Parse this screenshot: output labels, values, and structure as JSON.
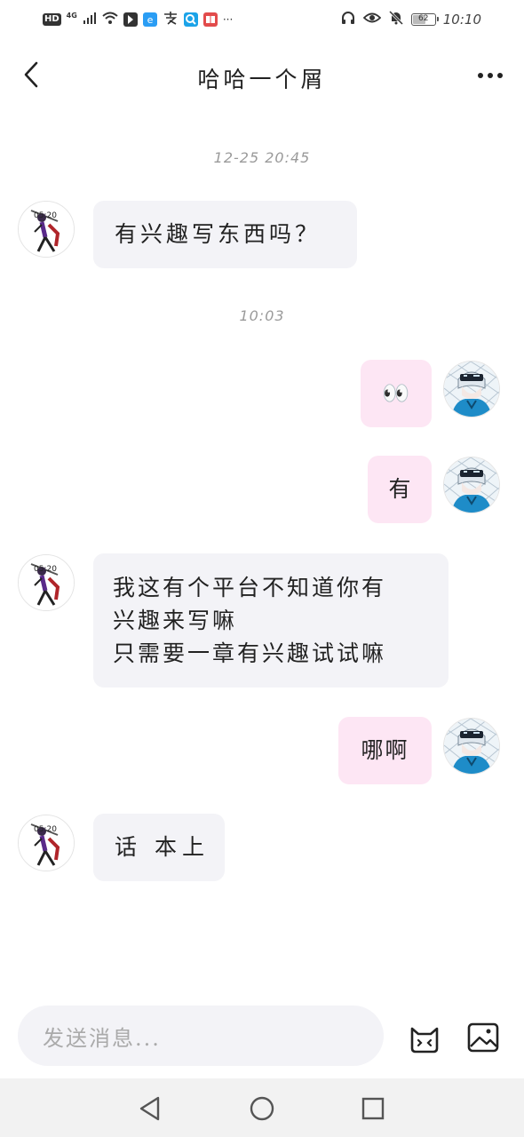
{
  "status_bar": {
    "network_label": "HD",
    "network_type": "4G",
    "more_indicator": "···",
    "battery_level": 62,
    "battery_text": "62",
    "time": "10:10"
  },
  "header": {
    "title": "哈哈一个屑"
  },
  "messages": [
    {
      "type": "timestamp",
      "text": "12-25 20:45"
    },
    {
      "type": "message",
      "direction": "in",
      "text": "有兴趣写东西吗？"
    },
    {
      "type": "timestamp",
      "text": "10:03"
    },
    {
      "type": "message",
      "direction": "out",
      "text": "👀"
    },
    {
      "type": "message",
      "direction": "out",
      "text": "有"
    },
    {
      "type": "message",
      "direction": "in",
      "text": "我这有个平台不知道你有\n兴趣来写嘛\n只需要一章有兴趣试试嘛"
    },
    {
      "type": "message",
      "direction": "out",
      "text": "哪啊"
    },
    {
      "type": "message",
      "direction": "in",
      "text": "话 本上"
    }
  ],
  "avatars": {
    "contact": {
      "label": "05:20"
    }
  },
  "composer": {
    "placeholder": "发送消息..."
  },
  "colors": {
    "incoming_bubble": "#f3f3f7",
    "outgoing_bubble": "#fde6f4",
    "timestamp": "#9a9a9a",
    "nav_bar": "#f2f2f2"
  },
  "icons": {
    "back": "chevron-left-icon",
    "more": "more-dots-icon",
    "emoji": "cat-face-icon",
    "image": "image-icon",
    "nav_back": "triangle-back-icon",
    "nav_home": "circle-home-icon",
    "nav_recent": "square-recents-icon"
  }
}
